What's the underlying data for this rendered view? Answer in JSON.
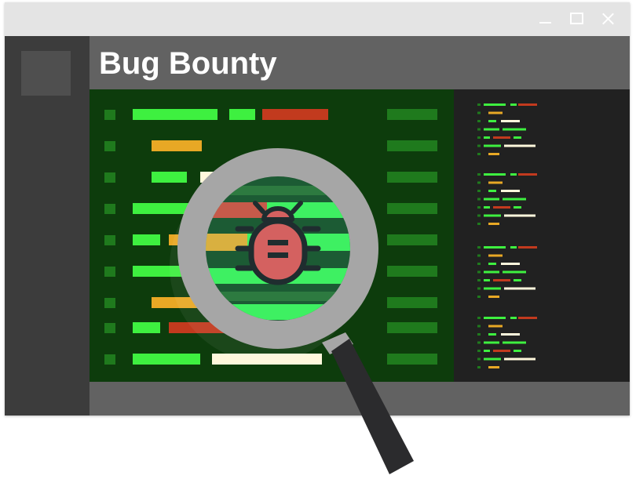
{
  "window": {
    "title": "Bug Bounty",
    "controls": [
      "minimize",
      "maximize",
      "close"
    ]
  },
  "illustration": {
    "icons": [
      "magnifying-glass-icon",
      "bug-icon"
    ]
  },
  "colors": {
    "titlebar": "#e4e4e4",
    "sidebar": "#3c3c3c",
    "header": "#626262",
    "code_background": "#0d3c0c",
    "minimap_background": "#212121",
    "bright_green": "#3ef040",
    "dark_green": "#1f7a1d",
    "red": "#c23a1e",
    "orange": "#e8a825",
    "cream": "#fff8dc",
    "magnifier_frame": "#a6a6a6",
    "magnifier_handle": "#2b2b2d",
    "bug_body": "#d46160",
    "bug_outline": "#1f2d2f"
  }
}
